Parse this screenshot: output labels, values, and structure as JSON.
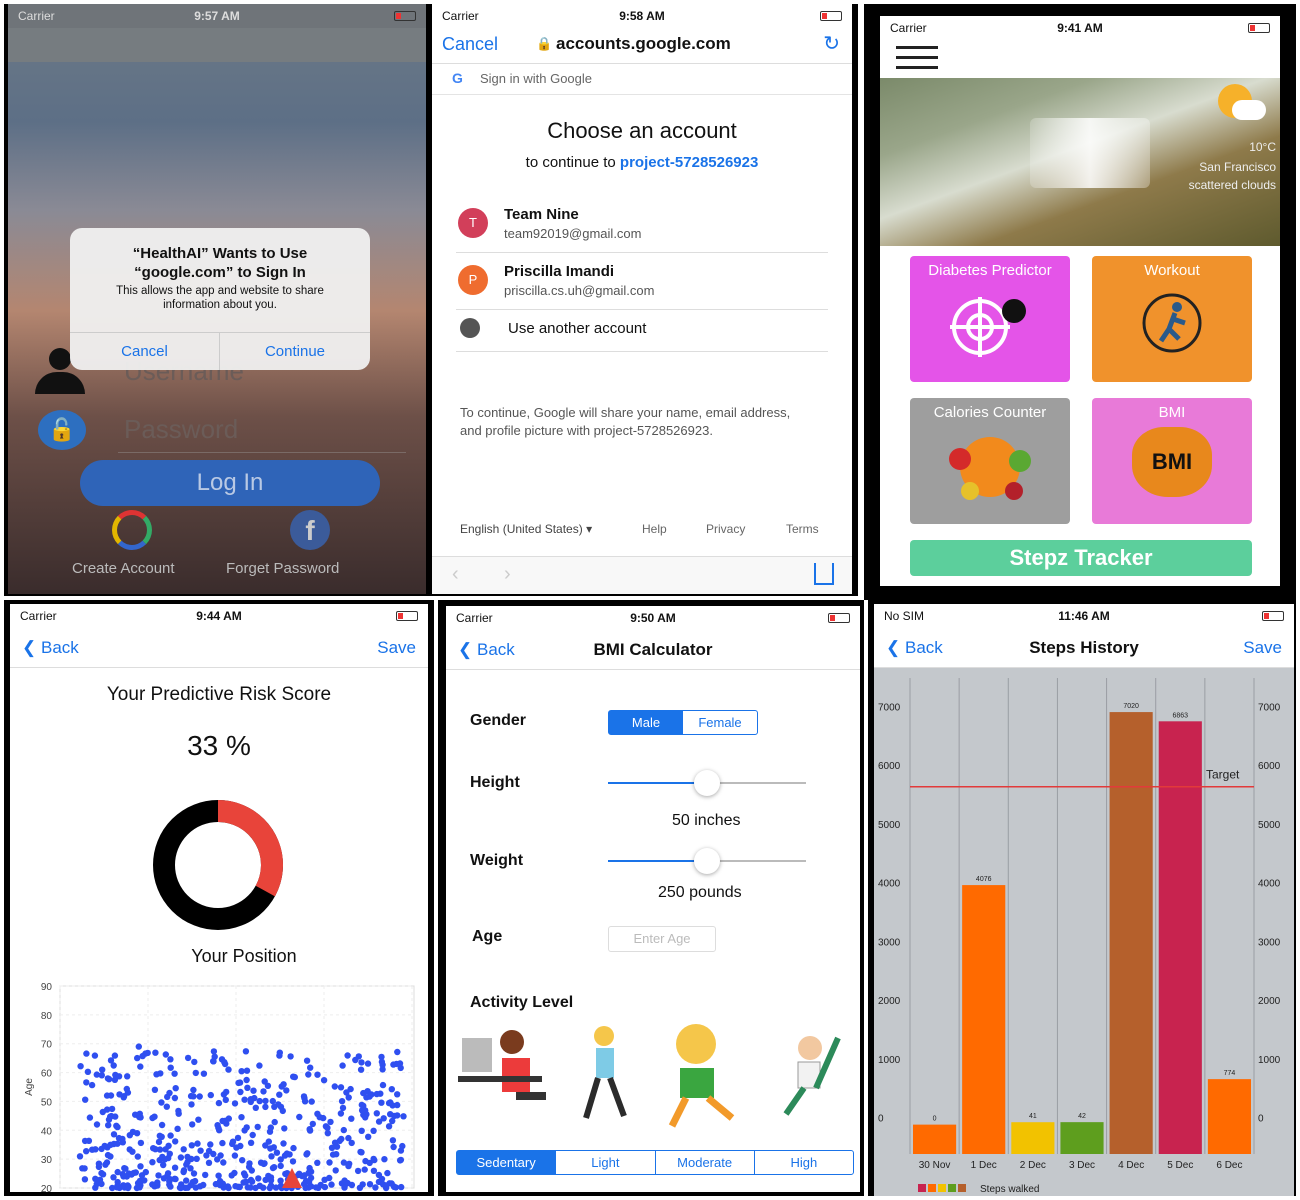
{
  "p1": {
    "carrier": "Carrier",
    "time": "9:57 AM",
    "alert_title": "“HealthAI” Wants to Use “google.com” to Sign In",
    "alert_msg": "This allows the app and website to share information about you.",
    "cancel": "Cancel",
    "continue": "Continue",
    "username_ph": "Username",
    "password_ph": "Password",
    "login": "Log In",
    "create": "Create Account",
    "forget": "Forget Password"
  },
  "p2": {
    "carrier": "Carrier",
    "time": "9:58 AM",
    "cancel": "Cancel",
    "url": "accounts.google.com",
    "signin": "Sign in with Google",
    "heading": "Choose an account",
    "continue_prefix": "to continue to",
    "project": "project-5728526923",
    "accounts": [
      {
        "initial": "T",
        "name": "Team Nine",
        "email": "team92019@gmail.com",
        "color": "#d23f5a"
      },
      {
        "initial": "P",
        "name": "Priscilla Imandi",
        "email": "priscilla.cs.uh@gmail.com",
        "color": "#ef6c2f"
      }
    ],
    "another": "Use another account",
    "notice": "To continue, Google will share your name, email address, and profile picture with project-5728526923.",
    "lang": "English (United States)",
    "help": "Help",
    "privacy": "Privacy",
    "terms": "Terms"
  },
  "p3": {
    "carrier": "Carrier",
    "time": "9:41 AM",
    "temp": "10°C",
    "city": "San Francisco",
    "weather": "scattered clouds",
    "tiles": [
      "Diabetes Predictor",
      "Workout",
      "Calories Counter",
      "BMI"
    ],
    "bmi_word": "BMI",
    "stepz": "Stepz Tracker",
    "colors": {
      "diabetes": "#e454e8",
      "workout": "#f0922c",
      "calories": "#9e9e9e",
      "bmi": "#e87ad8",
      "stepz": "#5ccf9c"
    }
  },
  "p4": {
    "carrier": "Carrier",
    "time": "9:44 AM",
    "back": "Back",
    "save": "Save",
    "title": "Your Predictive Risk Score",
    "score": "33 %",
    "position": "Your Position",
    "ylabel": "Age",
    "risk_fraction": 0.33
  },
  "p5": {
    "carrier": "Carrier",
    "time": "9:50 AM",
    "back": "Back",
    "title": "BMI Calculator",
    "gender": "Gender",
    "male": "Male",
    "female": "Female",
    "height": "Height",
    "height_val": "50 inches",
    "weight": "Weight",
    "weight_val": "250 pounds",
    "age": "Age",
    "age_ph": "Enter Age",
    "activity": "Activity Level",
    "levels": [
      "Sedentary",
      "Light",
      "Moderate",
      "High"
    ],
    "height_slider": 0.5,
    "weight_slider": 0.5
  },
  "p6": {
    "carrier": "No SIM",
    "time": "11:46 AM",
    "back": "Back",
    "title": "Steps History",
    "save": "Save",
    "target_label": "Target",
    "legend": "Steps walked"
  },
  "chart_data": [
    {
      "type": "scatter",
      "title": "Your Position",
      "ylabel": "Age",
      "ylim": [
        20,
        90
      ],
      "yticks": [
        20,
        30,
        40,
        50,
        60,
        70,
        80,
        90
      ],
      "series": [
        {
          "color": "#2f4ff0",
          "points": "dense cloud of points concentrated at ages 20-50, sparse up to 80"
        }
      ]
    },
    {
      "type": "bar",
      "title": "Steps History",
      "categories": [
        "30 Nov",
        "1 Dec",
        "2 Dec",
        "3 Dec",
        "4 Dec",
        "5 Dec",
        "6 Dec"
      ],
      "values": [
        0,
        4076,
        41,
        42,
        7020,
        6863,
        774
      ],
      "colors": [
        "#ff6a00",
        "#ff6a00",
        "#f2c200",
        "#5e9e1e",
        "#b5602c",
        "#c8234f",
        "#ff6a00"
      ],
      "ylim": [
        -500,
        7600
      ],
      "yticks": [
        0,
        1000,
        2000,
        3000,
        4000,
        5000,
        6000,
        7000
      ],
      "target": 5750,
      "target_label": "Target",
      "legend": "Steps walked"
    }
  ]
}
